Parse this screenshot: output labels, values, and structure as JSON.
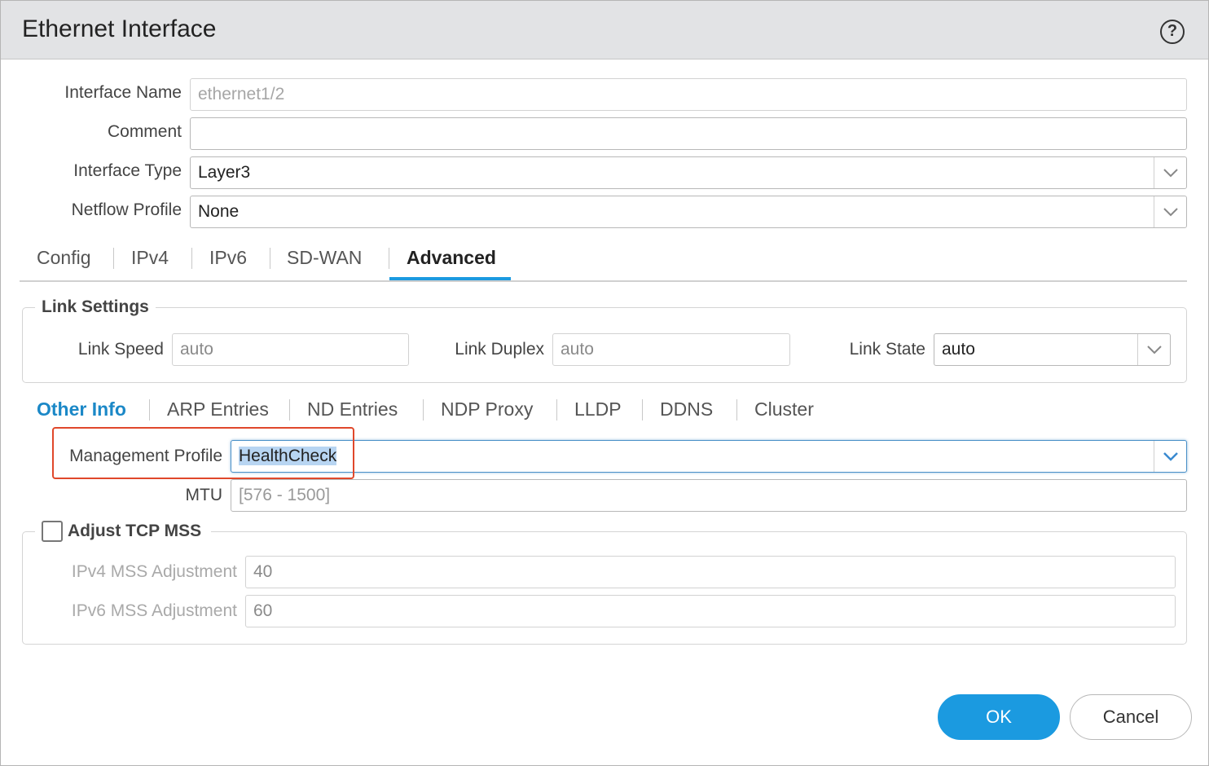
{
  "dialog": {
    "title": "Ethernet Interface",
    "help_icon": "question-circle-icon"
  },
  "fields": {
    "interface_name": {
      "label": "Interface Name",
      "value": "ethernet1/2"
    },
    "comment": {
      "label": "Comment",
      "value": ""
    },
    "interface_type": {
      "label": "Interface Type",
      "value": "Layer3"
    },
    "netflow_profile": {
      "label": "Netflow Profile",
      "value": "None"
    }
  },
  "tabs": [
    {
      "label": "Config"
    },
    {
      "label": "IPv4"
    },
    {
      "label": "IPv6"
    },
    {
      "label": "SD-WAN"
    },
    {
      "label": "Advanced",
      "active": true
    }
  ],
  "link_settings": {
    "title": "Link Settings",
    "link_speed": {
      "label": "Link Speed",
      "value": "auto"
    },
    "link_duplex": {
      "label": "Link Duplex",
      "value": "auto"
    },
    "link_state": {
      "label": "Link State",
      "value": "auto"
    }
  },
  "subtabs": [
    {
      "label": "Other Info",
      "active": true
    },
    {
      "label": "ARP Entries"
    },
    {
      "label": "ND Entries"
    },
    {
      "label": "NDP Proxy"
    },
    {
      "label": "LLDP"
    },
    {
      "label": "DDNS"
    },
    {
      "label": "Cluster"
    }
  ],
  "other_info": {
    "management_profile": {
      "label": "Management Profile",
      "value": "HealthCheck"
    },
    "mtu": {
      "label": "MTU",
      "placeholder": "[576 - 1500]"
    }
  },
  "tcp_mss": {
    "title": "Adjust TCP MSS",
    "checked": false,
    "ipv4": {
      "label": "IPv4 MSS Adjustment",
      "value": "40"
    },
    "ipv6": {
      "label": "IPv6 MSS Adjustment",
      "value": "60"
    }
  },
  "buttons": {
    "ok": "OK",
    "cancel": "Cancel"
  },
  "colors": {
    "accent": "#1b9ae0",
    "active_subtab": "#1b88c7",
    "highlight": "#e0482b"
  }
}
